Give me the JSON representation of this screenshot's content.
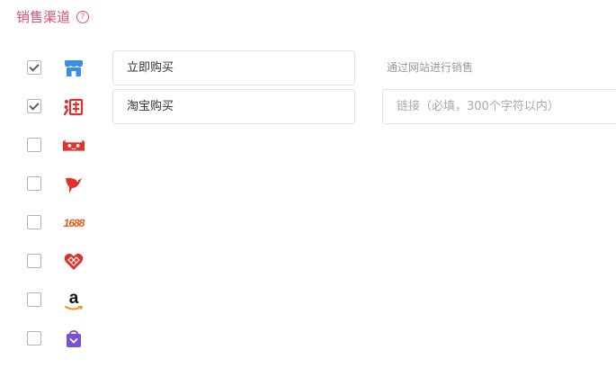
{
  "header": {
    "title": "销售渠道",
    "help_icon": "?"
  },
  "rows": [
    {
      "icon": "store-icon",
      "checked": true,
      "name": "立即购买",
      "hint": "通过网站进行销售"
    },
    {
      "icon": "taobao-icon",
      "checked": true,
      "name": "淘宝购买",
      "link_placeholder": "链接（必填，300个字符以内）"
    },
    {
      "icon": "tmall-icon",
      "checked": false
    },
    {
      "icon": "bird-icon",
      "checked": false
    },
    {
      "icon": "1688-icon",
      "label": "1688",
      "checked": false
    },
    {
      "icon": "heart-icon",
      "checked": false
    },
    {
      "icon": "amazon-icon",
      "label": "a",
      "checked": false
    },
    {
      "icon": "bag-icon",
      "checked": false
    }
  ],
  "colors": {
    "accent": "#d8527a",
    "store_blue": "#3a8ee6",
    "red": "#e0322b",
    "orange": "#e65c1c",
    "purple": "#7a4fd6"
  }
}
